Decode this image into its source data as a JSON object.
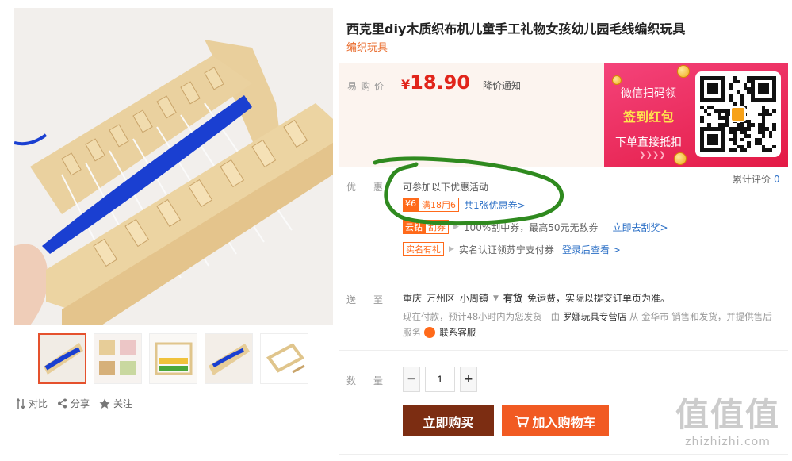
{
  "product": {
    "title": "西克里diy木质织布机儿童手工礼物女孩幼儿园毛线编织玩具",
    "subtitle": "编织玩具"
  },
  "price": {
    "label": "易购价",
    "currency": "¥",
    "amount": "18.90",
    "notify_label": "降价通知"
  },
  "promo_banner": {
    "line1": "微信扫码领",
    "line2": "签到红包",
    "line3": "下单直接抵扣",
    "arrows": "❯❯❯❯"
  },
  "rating": {
    "label": "累计评价",
    "count": "0"
  },
  "offers": {
    "label": "优惠",
    "intro": "可参加以下优惠活动",
    "coupon_amount": "¥6",
    "coupon_rule": "满18用6",
    "coupon_link": "共1张优惠券>",
    "scratch_tag1": "云钻",
    "scratch_tag2": "刮券",
    "scratch_text": "100%刮中券，最高50元无敌券",
    "scratch_link": "立即去刮奖>",
    "realname_tag": "实名有礼",
    "realname_text": "实名认证领苏宁支付券",
    "realname_link": "登录后查看 >"
  },
  "shipping": {
    "label": "送至",
    "city": "重庆",
    "district": "万州区",
    "town": "小周镇",
    "stock": "有货",
    "freight": "免运费，实际以提交订单页为准。",
    "line2_pre": "现在付款，预计48小时内为您发货",
    "line2_by": "由",
    "shop": "罗娜玩具专营店",
    "line2_post": "从 金华市 销售和发货，并提供售后",
    "service_label": "服务",
    "service_link": "联系客服"
  },
  "quantity": {
    "label": "数量",
    "value": "1",
    "minus": "−",
    "plus": "+"
  },
  "actions": {
    "buy_now": "立即购买",
    "add_cart": "加入购物车",
    "compare": "对比",
    "share": "分享",
    "follow": "关注"
  },
  "watermark": {
    "glyphs": "值值值",
    "domain": "zhizhizhi.com"
  },
  "colors": {
    "price_red": "#e1251b",
    "buy_brown": "#7c2d12",
    "cart_orange": "#f15a22",
    "link_blue": "#2b6fc6",
    "annotation_green": "#2f8a1f"
  }
}
